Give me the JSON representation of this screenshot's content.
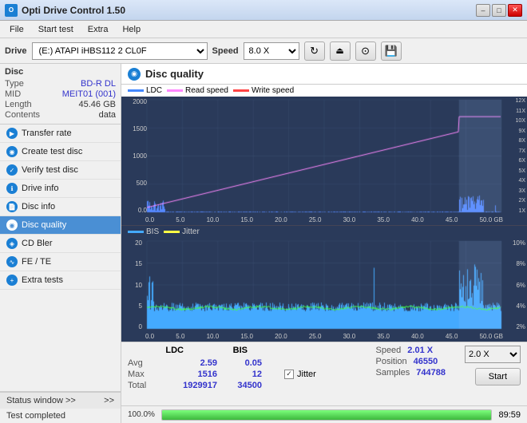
{
  "titleBar": {
    "title": "Opti Drive Control 1.50",
    "minLabel": "–",
    "maxLabel": "□",
    "closeLabel": "✕"
  },
  "menuBar": {
    "items": [
      "File",
      "Start test",
      "Extra",
      "Help"
    ]
  },
  "toolbar": {
    "driveLabel": "Drive",
    "driveValue": "(E:)  ATAPI iHBS112  2 CL0F",
    "speedLabel": "Speed",
    "speedValue": "8.0 X",
    "refreshIcon": "↻",
    "writeIcon": "✎",
    "burnIcon": "⊙",
    "saveIcon": "💾"
  },
  "sidebar": {
    "discTitle": "Disc",
    "discInfo": [
      {
        "key": "Type",
        "value": "BD-R DL",
        "colored": true
      },
      {
        "key": "MID",
        "value": "MEIT01 (001)",
        "colored": true
      },
      {
        "key": "Length",
        "value": "45.46 GB",
        "colored": false
      },
      {
        "key": "Contents",
        "value": "data",
        "colored": false
      }
    ],
    "buttons": [
      {
        "id": "transfer-rate",
        "label": "Transfer rate",
        "icon": "▶"
      },
      {
        "id": "create-test-disc",
        "label": "Create test disc",
        "icon": "◉"
      },
      {
        "id": "verify-test-disc",
        "label": "Verify test disc",
        "icon": "✓"
      },
      {
        "id": "drive-info",
        "label": "Drive info",
        "icon": "ℹ"
      },
      {
        "id": "disc-info",
        "label": "Disc info",
        "icon": "📄"
      },
      {
        "id": "disc-quality",
        "label": "Disc quality",
        "icon": "◉",
        "active": true
      },
      {
        "id": "cd-bler",
        "label": "CD Bler",
        "icon": "◈"
      },
      {
        "id": "fe-te",
        "label": "FE / TE",
        "icon": "∿"
      },
      {
        "id": "extra-tests",
        "label": "Extra tests",
        "icon": "+"
      }
    ],
    "statusWindowLabel": "Status window >>",
    "testCompletedLabel": "Test completed"
  },
  "discQuality": {
    "title": "Disc quality",
    "legend": {
      "ldc": {
        "label": "LDC",
        "color": "#4488ff"
      },
      "readSpeed": {
        "label": "Read speed",
        "color": "#ff88ff"
      },
      "writeSpeed": {
        "label": "Write speed",
        "color": "#ff4444"
      },
      "bis": {
        "label": "BIS",
        "color": "#44aaff"
      },
      "jitter": {
        "label": "Jitter",
        "color": "#ffff44"
      }
    }
  },
  "chart1": {
    "yLabels": [
      "2000",
      "1500",
      "1000",
      "500",
      "0.0"
    ],
    "yRight": [
      "12X",
      "11X",
      "10X",
      "9X",
      "8X",
      "7X",
      "6X",
      "5X",
      "4X",
      "3X",
      "2X",
      "1X"
    ],
    "xLabels": [
      "0.0",
      "5.0",
      "10.0",
      "15.0",
      "20.0",
      "25.0",
      "30.0",
      "35.0",
      "40.0",
      "45.0",
      "50.0 GB"
    ]
  },
  "chart2": {
    "yLabels": [
      "20",
      "15",
      "10",
      "5",
      "0"
    ],
    "yRight": [
      "10%",
      "8%",
      "6%",
      "4%",
      "2%"
    ],
    "xLabels": [
      "0.0",
      "5.0",
      "10.0",
      "15.0",
      "20.0",
      "25.0",
      "30.0",
      "35.0",
      "40.0",
      "45.0",
      "50.0 GB"
    ]
  },
  "stats": {
    "ldcHeader": "LDC",
    "bisHeader": "BIS",
    "jitterLabel": "Jitter",
    "jitterChecked": true,
    "avgLabel": "Avg",
    "maxLabel": "Max",
    "totalLabel": "Total",
    "ldcAvg": "2.59",
    "ldcMax": "1516",
    "ldcTotal": "1929917",
    "bisAvg": "0.05",
    "bisMax": "12",
    "bisTotal": "34500",
    "speedLabel": "Speed",
    "speedValue": "2.01 X",
    "positionLabel": "Position",
    "positionValue": "46550",
    "samplesLabel": "Samples",
    "samplesValue": "744788",
    "speedSelectValue": "2.0 X",
    "startLabel": "Start"
  },
  "bottomBar": {
    "progressPercent": "100.0%",
    "time": "89:59"
  }
}
